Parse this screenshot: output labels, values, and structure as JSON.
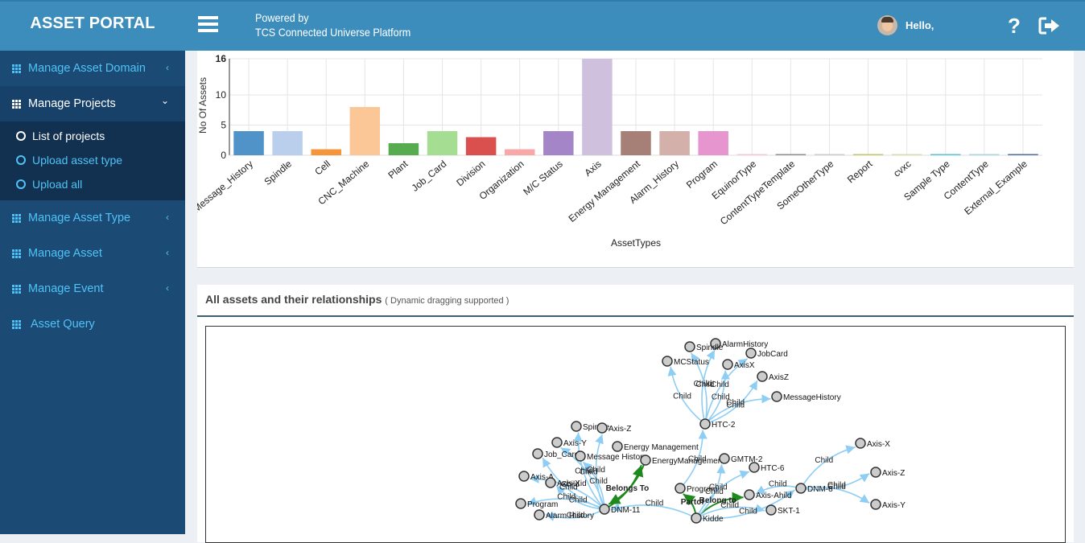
{
  "header": {
    "app_title": "ASSET PORTAL",
    "powered_line1": "Powered by",
    "powered_line2": "TCS Connected Universe Platform",
    "greeting": "Hello,",
    "help_glyph": "?",
    "icons": [
      "menu-icon",
      "avatar",
      "help-icon",
      "logout-icon"
    ]
  },
  "sidebar": {
    "items": [
      {
        "label": "Manage Asset Domain",
        "icon": "grid-icon",
        "chevron": "‹",
        "open": false
      },
      {
        "label": "Manage Projects",
        "icon": "grid-icon",
        "chevron": "⌄",
        "open": true,
        "children": [
          {
            "label": "List of projects",
            "icon": "circle-icon",
            "active": true
          },
          {
            "label": "Upload asset type",
            "icon": "circle-icon",
            "active": false
          },
          {
            "label": "Upload all",
            "icon": "circle-icon",
            "active": false
          }
        ]
      },
      {
        "label": "Manage Asset Type",
        "icon": "grid-icon",
        "chevron": "‹",
        "open": false
      },
      {
        "label": "Manage Asset",
        "icon": "grid-icon",
        "chevron": "‹",
        "open": false
      },
      {
        "label": "Manage Event",
        "icon": "grid-icon",
        "chevron": "‹",
        "open": false
      },
      {
        "label": "Asset Query",
        "icon": "grid-icon",
        "chevron": "",
        "open": false
      }
    ]
  },
  "chart_data": {
    "type": "bar",
    "title": "",
    "xlabel": "AssetTypes",
    "ylabel": "No Of Assets",
    "ylim": [
      0,
      16
    ],
    "yticks": [
      0,
      5,
      10,
      16
    ],
    "grid": true,
    "categories": [
      "Message_History",
      "Spindle",
      "Cell",
      "CNC_Machine",
      "Plant",
      "Job_Card",
      "Division",
      "Organization",
      "M/C Status",
      "Axis",
      "Energy Management",
      "Alarm_History",
      "Program",
      "EquinorType",
      "ContentTypeTemplate",
      "SomeOtherType",
      "Report",
      "cvxc",
      "Sample Type",
      "ContentType",
      "External_Example"
    ],
    "values": [
      4,
      4,
      1,
      8,
      2,
      4,
      3,
      1,
      4,
      16,
      4,
      4,
      4,
      0,
      0,
      0,
      0,
      0,
      0,
      0,
      0
    ],
    "colors": [
      "#4f93c8",
      "#b9cfeb",
      "#f5963a",
      "#fcc797",
      "#57ac4f",
      "#a5dd93",
      "#d9504f",
      "#f9a8a8",
      "#a486c8",
      "#cfc0dd",
      "#a67f76",
      "#d3b1aa",
      "#e795cf",
      "#f6c7d6",
      "#8f8f8f",
      "#cccccc",
      "#c6c76a",
      "#dcdcad",
      "#58c3d2",
      "#a9d7e1",
      "#4f6f9f"
    ]
  },
  "graph_panel": {
    "title": "All assets and their relationships",
    "subtitle": "( Dynamic dragging supported )",
    "nodes": [
      {
        "id": "AlarmHistory_a"
      },
      {
        "id": "Spindle_a"
      },
      {
        "id": "JobCard"
      },
      {
        "id": "MCStatus"
      },
      {
        "id": "AxisX"
      },
      {
        "id": "AxisZ"
      },
      {
        "id": "MessageHistory"
      },
      {
        "id": "HTC-2"
      },
      {
        "id": "Spindle"
      },
      {
        "id": "Axis-Z"
      },
      {
        "id": "Axis-Y"
      },
      {
        "id": "Energy Management"
      },
      {
        "id": "Job_Card"
      },
      {
        "id": "Message History"
      },
      {
        "id": "EnergyManagement"
      },
      {
        "id": "GMTM-2"
      },
      {
        "id": "HTC-6"
      },
      {
        "id": "Axis-A"
      },
      {
        "id": "Axis-Xid"
      },
      {
        "id": "Program"
      },
      {
        "id": "Program_b"
      },
      {
        "id": "Axis-Ahild"
      },
      {
        "id": "DNM-8"
      },
      {
        "id": "Axis-X"
      },
      {
        "id": "Axis-Z_b"
      },
      {
        "id": "Axis-Y_b"
      },
      {
        "id": "DNM-11"
      },
      {
        "id": "Alarm History"
      },
      {
        "id": "Kidde"
      },
      {
        "id": "SKT-1"
      }
    ],
    "node_labels": {
      "AlarmHistory_a": "AlarmHistory",
      "Spindle_a": "Spindle",
      "JobCard": "JobCard",
      "MCStatus": "MCStatus",
      "AxisX": "AxisX",
      "AxisZ": "AxisZ",
      "MessageHistory": "MessageHistory",
      "HTC-2": "HTC-2",
      "Spindle": "Spindle",
      "Axis-Z": "Axis-Z",
      "Axis-Y": "Axis-Y",
      "Energy Management": "Energy Management",
      "Job_Card": "Job_Card",
      "Message History": "Message History",
      "EnergyManagement": "EnergyManagement",
      "GMTM-2": "GMTM-2",
      "HTC-6": "HTC-6",
      "Axis-A": "Axis-A",
      "Axis-Xid": "Axis-Xid",
      "Program": "Program",
      "Program_b": "Program",
      "Axis-Ahild": "Axis-Ahild",
      "DNM-8": "DNM-8",
      "Axis-X": "Axis-X",
      "Axis-Z_b": "Axis-Z",
      "Axis-Y_b": "Axis-Y",
      "DNM-11": "DNM-11",
      "Alarm History": "Alarm History",
      "Kidde": "Kidde",
      "SKT-1": "SKT-1"
    },
    "links": [
      {
        "s": "HTC-2",
        "t": "MCStatus",
        "label": "Child",
        "kind": "child"
      },
      {
        "s": "HTC-2",
        "t": "Spindle_a",
        "label": "Child",
        "kind": "child"
      },
      {
        "s": "HTC-2",
        "t": "AlarmHistory_a",
        "label": "Child",
        "kind": "child"
      },
      {
        "s": "HTC-2",
        "t": "AxisX",
        "label": "Child",
        "kind": "child"
      },
      {
        "s": "HTC-2",
        "t": "JobCard",
        "label": "Child",
        "kind": "child"
      },
      {
        "s": "HTC-2",
        "t": "AxisZ",
        "label": "Child",
        "kind": "child"
      },
      {
        "s": "HTC-2",
        "t": "MessageHistory",
        "label": "Child",
        "kind": "child"
      },
      {
        "s": "Program",
        "t": "HTC-2",
        "label": "Child",
        "kind": "child"
      },
      {
        "s": "DNM-11",
        "t": "Spindle",
        "label": "Child",
        "kind": "child"
      },
      {
        "s": "DNM-11",
        "t": "Axis-Y",
        "label": "Child",
        "kind": "child"
      },
      {
        "s": "DNM-11",
        "t": "Job_Card",
        "label": "Child",
        "kind": "child"
      },
      {
        "s": "DNM-11",
        "t": "Message History",
        "label": "Child",
        "kind": "child"
      },
      {
        "s": "DNM-11",
        "t": "Axis-Z",
        "label": "Child",
        "kind": "child"
      },
      {
        "s": "DNM-11",
        "t": "Axis-A",
        "label": "Child",
        "kind": "child"
      },
      {
        "s": "DNM-11",
        "t": "Axis-Xid",
        "label": "Child",
        "kind": "child"
      },
      {
        "s": "DNM-11",
        "t": "Program_b",
        "label": "Child",
        "kind": "child"
      },
      {
        "s": "DNM-11",
        "t": "Alarm History",
        "label": "Child",
        "kind": "child"
      },
      {
        "s": "DNM-11",
        "t": "EnergyManagement",
        "label": "Belongs To",
        "kind": "belongs"
      },
      {
        "s": "EnergyManagement",
        "t": "DNM-11",
        "label": "",
        "kind": "belongs"
      },
      {
        "s": "Kidde",
        "t": "Program",
        "label": "Partof",
        "kind": "belongs"
      },
      {
        "s": "Kidde",
        "t": "Axis-Ahild",
        "label": "Belong to",
        "kind": "belongs"
      },
      {
        "s": "Kidde",
        "t": "GMTM-2",
        "label": "Child",
        "kind": "child"
      },
      {
        "s": "Kidde",
        "t": "HTC-6",
        "label": "Child",
        "kind": "child"
      },
      {
        "s": "Kidde",
        "t": "DNM-8",
        "label": "Child",
        "kind": "child"
      },
      {
        "s": "Kidde",
        "t": "SKT-1",
        "label": "Child",
        "kind": "child"
      },
      {
        "s": "Kidde",
        "t": "DNM-11",
        "label": "Child",
        "kind": "child"
      },
      {
        "s": "DNM-8",
        "t": "Axis-X",
        "label": "Child",
        "kind": "child"
      },
      {
        "s": "DNM-8",
        "t": "Axis-Z_b",
        "label": "Child",
        "kind": "child"
      },
      {
        "s": "DNM-8",
        "t": "Axis-Y_b",
        "label": "Child",
        "kind": "child"
      },
      {
        "s": "DNM-8",
        "t": "Axis-Ahild",
        "label": "Child",
        "kind": "child"
      }
    ],
    "colors": {
      "child_link": "#8ecdf4",
      "belongs_link": "#1e8a1e",
      "node_fill": "#cccccc",
      "node_stroke": "#333333"
    }
  }
}
